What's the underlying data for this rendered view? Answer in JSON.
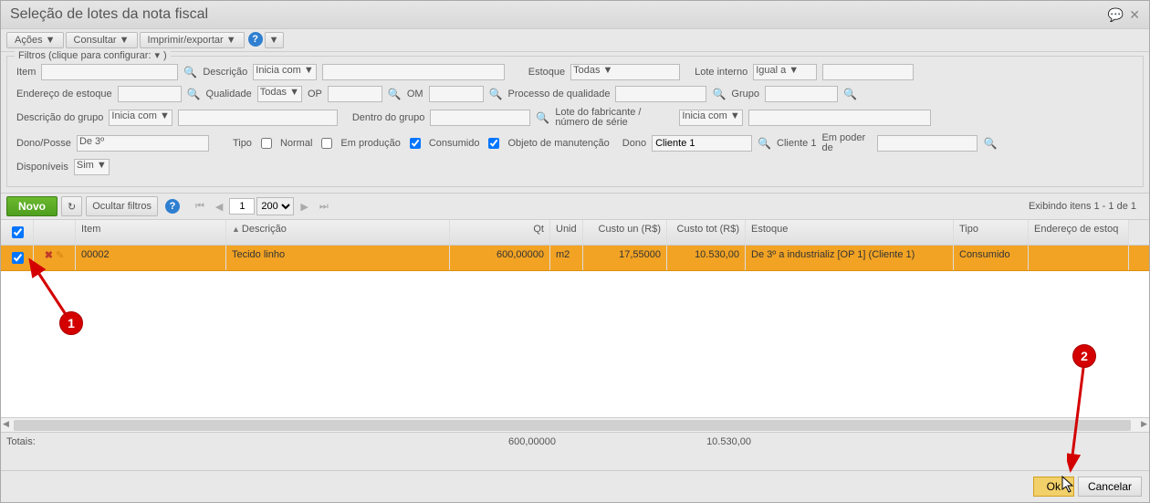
{
  "window": {
    "title": "Seleção de lotes da nota fiscal"
  },
  "menubar": {
    "acoes": "Ações ▼",
    "consultar": "Consultar ▼",
    "imprimir": "Imprimir/exportar ▼",
    "extra": "▼"
  },
  "filters": {
    "legend": "Filtros (clique para configurar: ",
    "item_label": "Item",
    "descricao_label": "Descrição",
    "inicia_com": "Inicia com ▼",
    "estoque_label": "Estoque",
    "todas": "Todas ▼",
    "lote_interno_label": "Lote interno",
    "igual_a": "Igual a   ▼",
    "endereco_label": "Endereço de estoque",
    "qualidade_label": "Qualidade",
    "op_label": "OP",
    "om_label": "OM",
    "processo_label": "Processo de qualidade",
    "grupo_label": "Grupo",
    "desc_grupo_label": "Descrição do grupo",
    "dentro_grupo_label": "Dentro do grupo",
    "lote_fab_label": "Lote do fabricante / número de série",
    "dono_posse_label": "Dono/Posse",
    "de3": "De 3º",
    "tipo_label": "Tipo",
    "chk_normal": "Normal",
    "chk_producao": "Em produção",
    "chk_consumido": "Consumido",
    "chk_objeto": "Objeto de manutenção",
    "dono_label": "Dono",
    "cliente1": "Cliente 1",
    "cliente1_lbl": "Cliente 1",
    "em_poder_label": "Em poder de",
    "disponiveis_label": "Disponíveis",
    "sim": "Sim ▼"
  },
  "toolbar": {
    "novo": "Novo",
    "ocultar": "Ocultar filtros",
    "page": "1",
    "page_size": "200",
    "count": "Exibindo itens 1 - 1 de 1"
  },
  "columns": {
    "item": "Item",
    "descricao": "Descrição",
    "qt": "Qt",
    "unid": "Unid",
    "custo_un": "Custo un (R$)",
    "custo_tot": "Custo tot (R$)",
    "estoque": "Estoque",
    "tipo": "Tipo",
    "endereco": "Endereço de estoq"
  },
  "rows": [
    {
      "item": "00002",
      "descricao": "Tecido linho",
      "qt": "600,00000",
      "unid": "m2",
      "custo_un": "17,55000",
      "custo_tot": "10.530,00",
      "estoque": "De 3º a industrializ [OP 1] (Cliente 1)",
      "tipo": "Consumido",
      "endereco": ""
    }
  ],
  "totals": {
    "label": "Totais:",
    "qt": "600,00000",
    "ctot": "10.530,00"
  },
  "footer": {
    "ok": "Ok",
    "cancel": "Cancelar"
  },
  "annotations": {
    "a1": "1",
    "a2": "2"
  }
}
